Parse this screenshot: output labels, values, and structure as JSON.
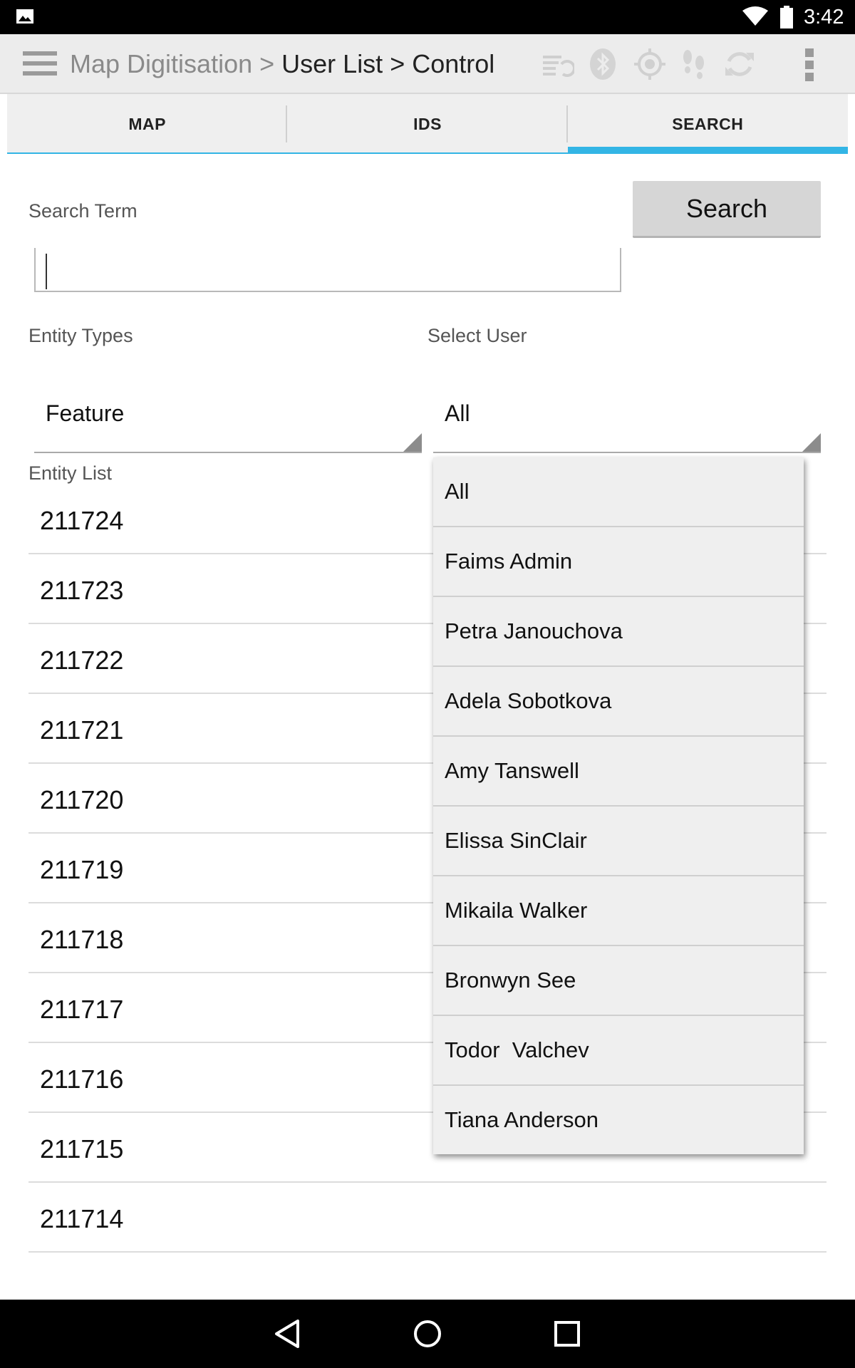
{
  "status_bar": {
    "time": "3:42",
    "icons": [
      "image-notification-icon",
      "wifi-icon",
      "battery-icon"
    ]
  },
  "action_bar": {
    "crumb_app": "Map Digitisation",
    "crumb_sep": " > ",
    "crumb_rest": "User List > Control",
    "icons": [
      "sync-list-icon",
      "bluetooth-icon",
      "gps-icon",
      "tracker-footsteps-icon",
      "sync-icon",
      "overflow-menu-icon"
    ]
  },
  "tabs": [
    {
      "label": "MAP",
      "active": false
    },
    {
      "label": "IDS",
      "active": false
    },
    {
      "label": "SEARCH",
      "active": true
    }
  ],
  "search": {
    "term_label": "Search Term",
    "button_label": "Search",
    "input_value": ""
  },
  "entity_types": {
    "label": "Entity Types",
    "selected": "Feature"
  },
  "select_user": {
    "label": "Select User",
    "selected": "All",
    "options": [
      "All",
      "Faims Admin",
      "Petra Janouchova",
      "Adela Sobotkova",
      "Amy Tanswell",
      "Elissa SinClair",
      "Mikaila Walker",
      "Bronwyn See",
      "Todor  Valchev",
      "Tiana Anderson"
    ]
  },
  "entity_list": {
    "label": "Entity List",
    "items": [
      "211724",
      "211723",
      "211722",
      "211721",
      "211720",
      "211719",
      "211718",
      "211717",
      "211716",
      "211715",
      "211714"
    ]
  },
  "colors": {
    "accent": "#33b5e5",
    "action_bar": "#ececec",
    "tab_bar": "#efefef",
    "button": "#d6d6d6"
  }
}
